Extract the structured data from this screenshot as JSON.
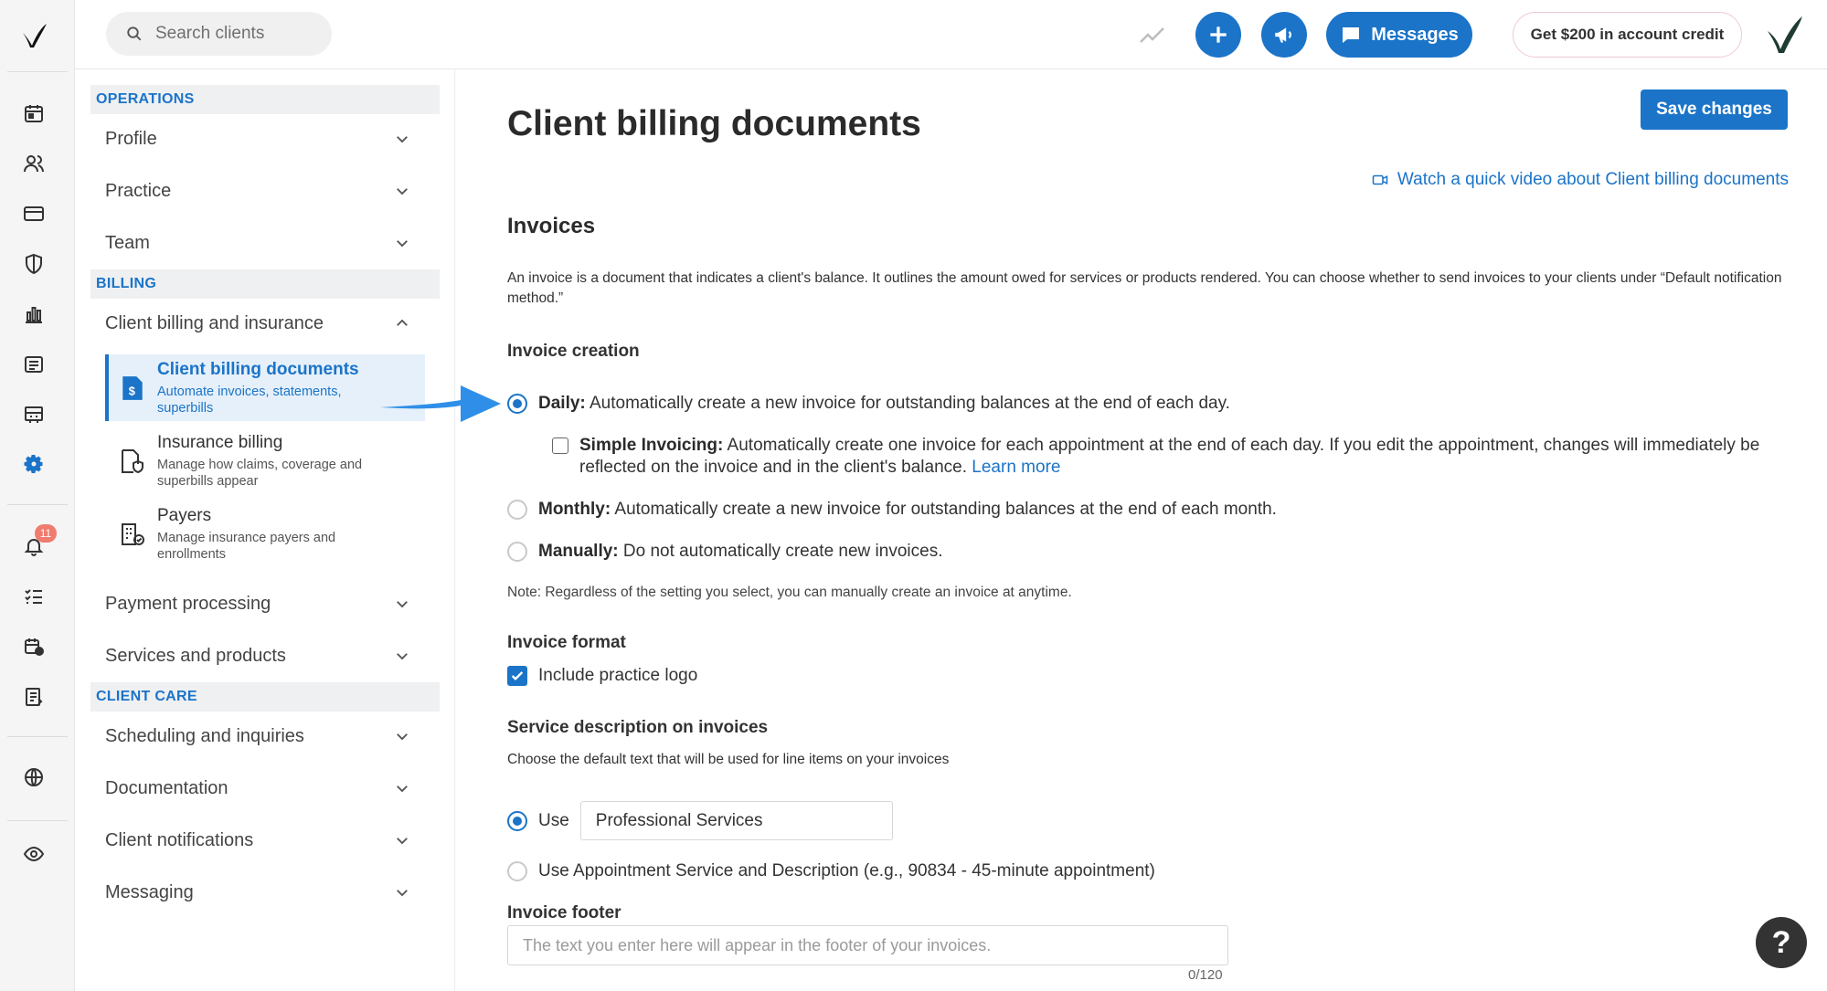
{
  "search": {
    "placeholder": "Search clients"
  },
  "topbar": {
    "messages_label": "Messages",
    "credit_label": "Get $200 in account credit"
  },
  "rail": {
    "notifications_count": "11"
  },
  "nav": {
    "sections": {
      "operations": "OPERATIONS",
      "billing": "BILLING",
      "client_care": "CLIENT CARE"
    },
    "items": {
      "profile": "Profile",
      "practice": "Practice",
      "team": "Team",
      "client_billing_insurance": "Client billing and insurance",
      "payment_processing": "Payment processing",
      "services_products": "Services and products",
      "scheduling_inquiries": "Scheduling and inquiries",
      "documentation": "Documentation",
      "client_notifications": "Client notifications",
      "messaging": "Messaging"
    },
    "sub": {
      "billing_docs_title": "Client billing documents",
      "billing_docs_desc": "Automate invoices, statements, superbills",
      "insurance_title": "Insurance billing",
      "insurance_desc": "Manage how claims, coverage and superbills appear",
      "payers_title": "Payers",
      "payers_desc": "Manage insurance payers and enrollments"
    }
  },
  "main": {
    "title": "Client billing documents",
    "save_label": "Save changes",
    "video_link": "Watch a quick video about Client billing documents",
    "invoices_heading": "Invoices",
    "invoices_desc": "An invoice is a document that indicates a client's balance. It outlines the amount owed for services or products rendered. You can choose whether to send invoices to your clients under “Default notification method.”",
    "creation_heading": "Invoice creation",
    "daily_label": "Daily:",
    "daily_text": "Automatically create a new invoice for outstanding balances at the end of each day.",
    "simple_label": "Simple Invoicing:",
    "simple_text": "Automatically create one invoice for each appointment at the end of each day. If you edit the appointment, changes will immediately be reflected on the invoice and in the client's balance.",
    "learn_more": "Learn more",
    "monthly_label": "Monthly:",
    "monthly_text": "Automatically create a new invoice for outstanding balances at the end of each month.",
    "manually_label": "Manually:",
    "manually_text": "Do not automatically create new invoices.",
    "note": "Note: Regardless of the setting you select, you can manually create an invoice at anytime.",
    "format_heading": "Invoice format",
    "include_logo": "Include practice logo",
    "service_heading": "Service description on invoices",
    "service_desc": "Choose the default text that will be used for line items on your invoices",
    "use_label": "Use",
    "use_value": "Professional Services",
    "use_appt_label": "Use Appointment Service and Description (e.g., 90834 - 45-minute appointment)",
    "footer_heading": "Invoice footer",
    "footer_placeholder": "The text you enter here will appear in the footer of your invoices.",
    "footer_counter": "0/120"
  },
  "help_label": "?"
}
